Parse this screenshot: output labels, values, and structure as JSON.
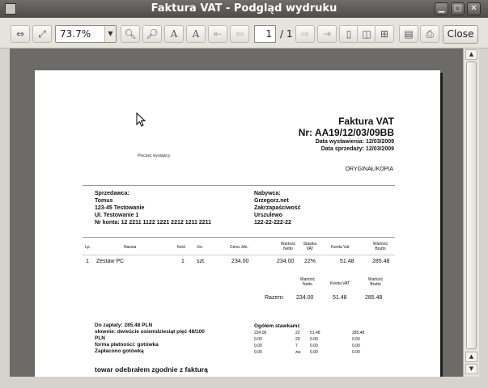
{
  "window": {
    "title": "Faktura VAT - Podgląd wydruku"
  },
  "toolbar": {
    "zoom": "73.7%",
    "page_current": "1",
    "page_total": "/ 1",
    "close_label": "Close"
  },
  "invoice": {
    "title": "Faktura VAT",
    "number": "Nr: AA19/12/03/09BB",
    "issue_date": "Data wystawienia: 12/03/2009",
    "sale_date": "Data sprzedaży: 12/03/2009",
    "stamp": "Pieczęć wystawcy",
    "copy_label": "ORYGINAŁ/KOPIA",
    "seller": {
      "heading": "Sprzedawca:",
      "lines": [
        "Tomus",
        "123-45 Testowanie",
        "Ul. Testowanie 1",
        "Nr konta: 12 2211 1122 1221 2212 1211 2211"
      ]
    },
    "buyer": {
      "heading": "Nabywca:",
      "lines": [
        "Grzegorz.net",
        "Zakrzapaściwość",
        "Urszulewo",
        "122-22-222-22"
      ]
    },
    "table": {
      "headers": [
        "Lp.",
        "Nazwa",
        "Ilość",
        "Jm.",
        "Cena Jdn.",
        "Wartość Netto",
        "Stawka VAT",
        "Kwota Vat",
        "Wartość Brutto"
      ],
      "row": [
        "1",
        "Zestaw PC",
        "1",
        "szt.",
        "234.00",
        "234.00",
        "22%",
        "51.48",
        "285.48"
      ]
    },
    "totals": {
      "headers": [
        "Wartość Netto",
        "Kwota VAT",
        "Wartość Brutto"
      ],
      "label": "Razem:",
      "values": [
        "234.00",
        "51.48",
        "285.48"
      ]
    },
    "payment": {
      "to_pay": "Do zapłaty: 285.48 PLN",
      "in_words": "słownie: dwieście osiemdziesiąt pięć 48/100",
      "currency": "PLN",
      "method": "forma płatności: gotówka",
      "paid": "Zapłacono gotówką"
    },
    "rates": {
      "heading": "Ogółem stawkami:",
      "rows": [
        [
          "234.00",
          "22",
          "51.48",
          "285.48"
        ],
        [
          "0.00",
          "29",
          "0.00",
          "0.00"
        ],
        [
          "0.00",
          "7",
          "0.00",
          "0.00"
        ],
        [
          "0.00",
          "zw.",
          "0.00",
          "0.00"
        ]
      ]
    },
    "received": "towar odebrałem zgodnie z fakturą"
  }
}
